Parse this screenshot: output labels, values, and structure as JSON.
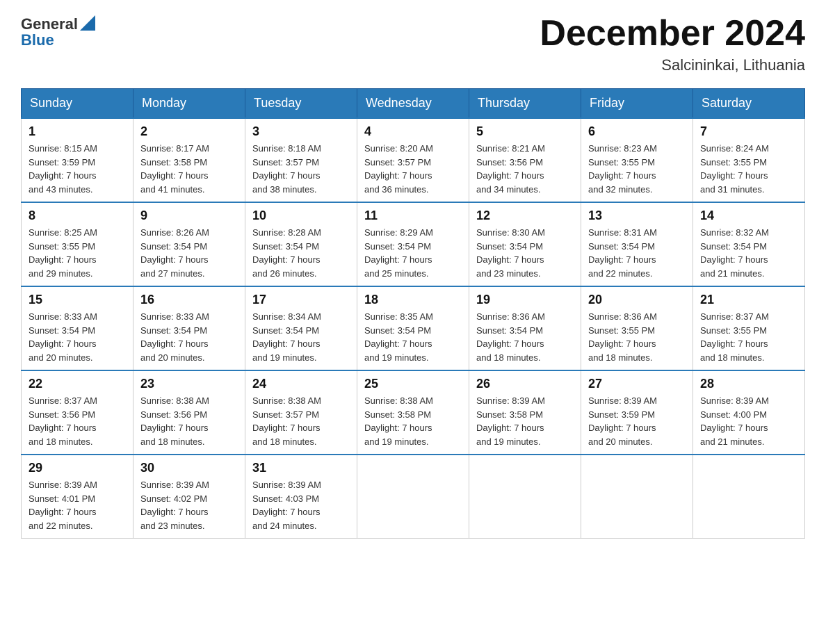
{
  "header": {
    "logo_general": "General",
    "logo_blue": "Blue",
    "month_title": "December 2024",
    "location": "Salcininkai, Lithuania"
  },
  "weekdays": [
    "Sunday",
    "Monday",
    "Tuesday",
    "Wednesday",
    "Thursday",
    "Friday",
    "Saturday"
  ],
  "weeks": [
    [
      {
        "day": "1",
        "sunrise": "8:15 AM",
        "sunset": "3:59 PM",
        "daylight": "7 hours and 43 minutes."
      },
      {
        "day": "2",
        "sunrise": "8:17 AM",
        "sunset": "3:58 PM",
        "daylight": "7 hours and 41 minutes."
      },
      {
        "day": "3",
        "sunrise": "8:18 AM",
        "sunset": "3:57 PM",
        "daylight": "7 hours and 38 minutes."
      },
      {
        "day": "4",
        "sunrise": "8:20 AM",
        "sunset": "3:57 PM",
        "daylight": "7 hours and 36 minutes."
      },
      {
        "day": "5",
        "sunrise": "8:21 AM",
        "sunset": "3:56 PM",
        "daylight": "7 hours and 34 minutes."
      },
      {
        "day": "6",
        "sunrise": "8:23 AM",
        "sunset": "3:55 PM",
        "daylight": "7 hours and 32 minutes."
      },
      {
        "day": "7",
        "sunrise": "8:24 AM",
        "sunset": "3:55 PM",
        "daylight": "7 hours and 31 minutes."
      }
    ],
    [
      {
        "day": "8",
        "sunrise": "8:25 AM",
        "sunset": "3:55 PM",
        "daylight": "7 hours and 29 minutes."
      },
      {
        "day": "9",
        "sunrise": "8:26 AM",
        "sunset": "3:54 PM",
        "daylight": "7 hours and 27 minutes."
      },
      {
        "day": "10",
        "sunrise": "8:28 AM",
        "sunset": "3:54 PM",
        "daylight": "7 hours and 26 minutes."
      },
      {
        "day": "11",
        "sunrise": "8:29 AM",
        "sunset": "3:54 PM",
        "daylight": "7 hours and 25 minutes."
      },
      {
        "day": "12",
        "sunrise": "8:30 AM",
        "sunset": "3:54 PM",
        "daylight": "7 hours and 23 minutes."
      },
      {
        "day": "13",
        "sunrise": "8:31 AM",
        "sunset": "3:54 PM",
        "daylight": "7 hours and 22 minutes."
      },
      {
        "day": "14",
        "sunrise": "8:32 AM",
        "sunset": "3:54 PM",
        "daylight": "7 hours and 21 minutes."
      }
    ],
    [
      {
        "day": "15",
        "sunrise": "8:33 AM",
        "sunset": "3:54 PM",
        "daylight": "7 hours and 20 minutes."
      },
      {
        "day": "16",
        "sunrise": "8:33 AM",
        "sunset": "3:54 PM",
        "daylight": "7 hours and 20 minutes."
      },
      {
        "day": "17",
        "sunrise": "8:34 AM",
        "sunset": "3:54 PM",
        "daylight": "7 hours and 19 minutes."
      },
      {
        "day": "18",
        "sunrise": "8:35 AM",
        "sunset": "3:54 PM",
        "daylight": "7 hours and 19 minutes."
      },
      {
        "day": "19",
        "sunrise": "8:36 AM",
        "sunset": "3:54 PM",
        "daylight": "7 hours and 18 minutes."
      },
      {
        "day": "20",
        "sunrise": "8:36 AM",
        "sunset": "3:55 PM",
        "daylight": "7 hours and 18 minutes."
      },
      {
        "day": "21",
        "sunrise": "8:37 AM",
        "sunset": "3:55 PM",
        "daylight": "7 hours and 18 minutes."
      }
    ],
    [
      {
        "day": "22",
        "sunrise": "8:37 AM",
        "sunset": "3:56 PM",
        "daylight": "7 hours and 18 minutes."
      },
      {
        "day": "23",
        "sunrise": "8:38 AM",
        "sunset": "3:56 PM",
        "daylight": "7 hours and 18 minutes."
      },
      {
        "day": "24",
        "sunrise": "8:38 AM",
        "sunset": "3:57 PM",
        "daylight": "7 hours and 18 minutes."
      },
      {
        "day": "25",
        "sunrise": "8:38 AM",
        "sunset": "3:58 PM",
        "daylight": "7 hours and 19 minutes."
      },
      {
        "day": "26",
        "sunrise": "8:39 AM",
        "sunset": "3:58 PM",
        "daylight": "7 hours and 19 minutes."
      },
      {
        "day": "27",
        "sunrise": "8:39 AM",
        "sunset": "3:59 PM",
        "daylight": "7 hours and 20 minutes."
      },
      {
        "day": "28",
        "sunrise": "8:39 AM",
        "sunset": "4:00 PM",
        "daylight": "7 hours and 21 minutes."
      }
    ],
    [
      {
        "day": "29",
        "sunrise": "8:39 AM",
        "sunset": "4:01 PM",
        "daylight": "7 hours and 22 minutes."
      },
      {
        "day": "30",
        "sunrise": "8:39 AM",
        "sunset": "4:02 PM",
        "daylight": "7 hours and 23 minutes."
      },
      {
        "day": "31",
        "sunrise": "8:39 AM",
        "sunset": "4:03 PM",
        "daylight": "7 hours and 24 minutes."
      },
      null,
      null,
      null,
      null
    ]
  ],
  "labels": {
    "sunrise": "Sunrise:",
    "sunset": "Sunset:",
    "daylight": "Daylight:"
  }
}
